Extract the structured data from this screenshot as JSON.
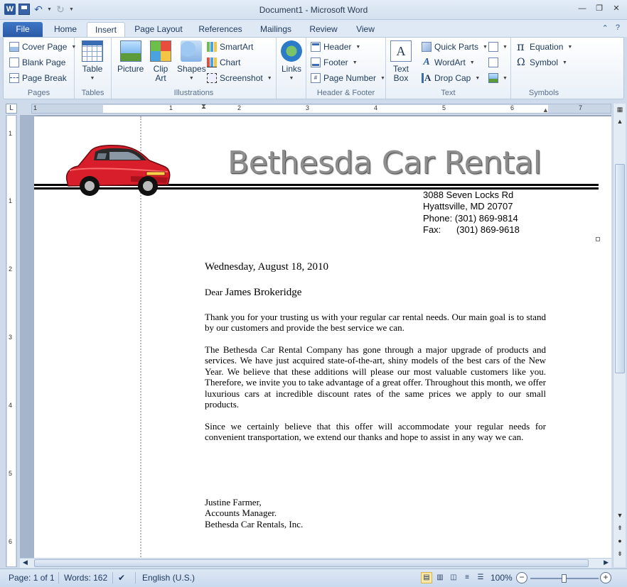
{
  "window": {
    "title": "Document1 - Microsoft Word",
    "word_icon": "W",
    "controls": [
      "minimize-icon",
      "restore-icon",
      "close-icon"
    ]
  },
  "tabs": [
    {
      "label": "File",
      "kind": "file"
    },
    {
      "label": "Home"
    },
    {
      "label": "Insert",
      "active": true
    },
    {
      "label": "Page Layout"
    },
    {
      "label": "References"
    },
    {
      "label": "Mailings"
    },
    {
      "label": "Review"
    },
    {
      "label": "View"
    }
  ],
  "ribbon": {
    "groups": {
      "pages": {
        "label": "Pages",
        "items": [
          "Cover Page",
          "Blank Page",
          "Page Break"
        ]
      },
      "tables": {
        "label": "Tables",
        "table": "Table"
      },
      "illustrations": {
        "label": "Illustrations",
        "picture": "Picture",
        "clip_art_1": "Clip",
        "clip_art_2": "Art",
        "shapes": "Shapes",
        "smartart": "SmartArt",
        "chart": "Chart",
        "screenshot": "Screenshot"
      },
      "links": {
        "label": "",
        "links": "Links"
      },
      "header_footer": {
        "label": "Header & Footer",
        "header": "Header",
        "footer": "Footer",
        "page_number": "Page Number"
      },
      "text": {
        "label": "Text",
        "textbox_1": "Text",
        "textbox_2": "Box",
        "quick_parts": "Quick Parts",
        "wordart": "WordArt",
        "drop_cap": "Drop Cap"
      },
      "symbols": {
        "label": "Symbols",
        "equation": "Equation",
        "symbol": "Symbol"
      }
    }
  },
  "ruler": {
    "h_numbers": [
      "1",
      "1",
      "2",
      "3",
      "4",
      "5",
      "6",
      "7"
    ],
    "v_numbers": [
      "1",
      "1",
      "2",
      "3",
      "4",
      "5",
      "6"
    ]
  },
  "document": {
    "letterhead": {
      "company": "Bethesda Car Rental",
      "address_lines": [
        "3088 Seven Locks Rd",
        "Hyattsville, MD 20707",
        "Phone: (301) 869-9814",
        "Fax:      (301) 869-9618"
      ]
    },
    "date": "Wednesday, August 18, 2010",
    "salutation_word": "Dear",
    "salutation_name": "James Brokeridge",
    "paragraphs": [
      "Thank you for your trusting us with your regular car rental needs. Our main goal is to stand by our customers and provide the best service we can.",
      "The Bethesda Car Rental Company has gone through a major upgrade of products and services. We have just acquired state-of-the-art, shiny models of the best cars of the New Year. We believe that these additions will please our most valuable customers like you. Therefore, we invite you to take advantage of a great offer. Throughout this month, we offer luxurious cars at incredible discount rates of the same prices we apply to our small products.",
      "Since we certainly believe that this offer will  accommodate your regular needs for convenient transportation, we extend our thanks and hope to assist in any way we can."
    ],
    "signature": [
      "Justine Farmer,",
      "Accounts Manager.",
      "Bethesda Car Rentals, Inc."
    ]
  },
  "status": {
    "page": "Page: 1 of 1",
    "words": "Words: 162",
    "language": "English (U.S.)",
    "zoom": "100%"
  },
  "colors": {
    "accent": "#2b579a",
    "car": "#d81e2a"
  }
}
